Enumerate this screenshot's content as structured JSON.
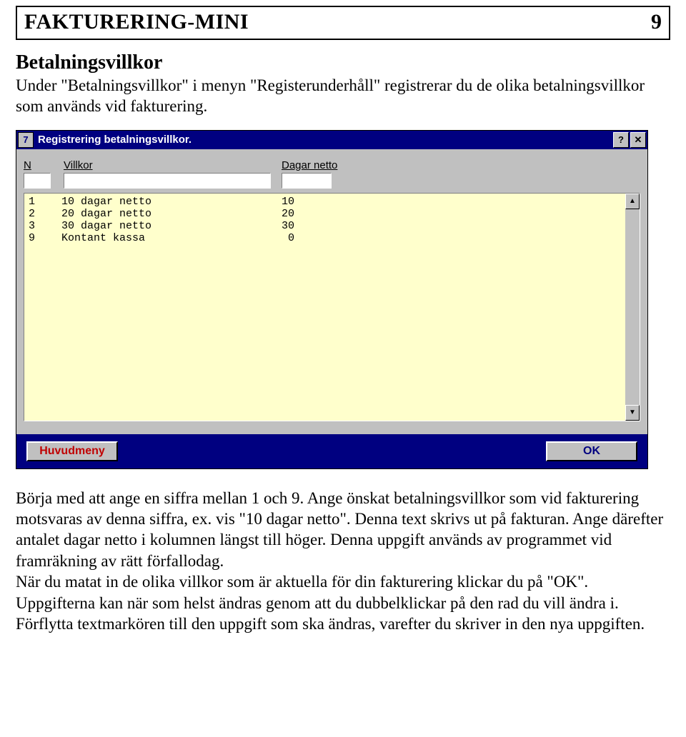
{
  "doc": {
    "header_title": "FAKTURERING-MINI",
    "page_number": "9",
    "section_heading": "Betalningsvillkor",
    "intro": "Under \"Betalningsvillkor\" i menyn \"Registerunderhåll\" registrerar du de olika betalningsvillkor som används vid fakturering.",
    "body": "Börja med att ange en siffra mellan 1 och 9. Ange önskat betalningsvillkor som vid fakturering motsvaras av denna siffra, ex. vis \"10 dagar netto\". Denna text skrivs ut på fakturan. Ange därefter antalet dagar netto i kolumnen längst till höger. Denna uppgift används av programmet vid framräkning av rätt förfallodag.\nNär du matat in de olika villkor som är aktuella för din fakturering klickar du på \"OK\". Uppgifterna kan när som helst ändras genom att du dubbelklickar på den rad du vill ändra i. Förflytta textmarkören till den uppgift som ska ändras, varefter du skriver in den nya uppgiften."
  },
  "win": {
    "sys_glyph": "7",
    "title": "Registrering betalningsvillkor.",
    "labels": {
      "n": "N",
      "villkor": "Villkor",
      "dagar_netto": "Dagar netto"
    },
    "rows": [
      {
        "n": "1",
        "villkor": "10 dagar netto",
        "dagar": "10"
      },
      {
        "n": "2",
        "villkor": "20 dagar netto",
        "dagar": "20"
      },
      {
        "n": "3",
        "villkor": "30 dagar netto",
        "dagar": "30"
      },
      {
        "n": "9",
        "villkor": "Kontant kassa",
        "dagar": "0"
      }
    ],
    "buttons": {
      "main_menu": "Huvudmeny",
      "ok": "OK"
    }
  },
  "icons": {
    "help": "?",
    "close": "✕",
    "up": "▲",
    "down": "▼"
  }
}
